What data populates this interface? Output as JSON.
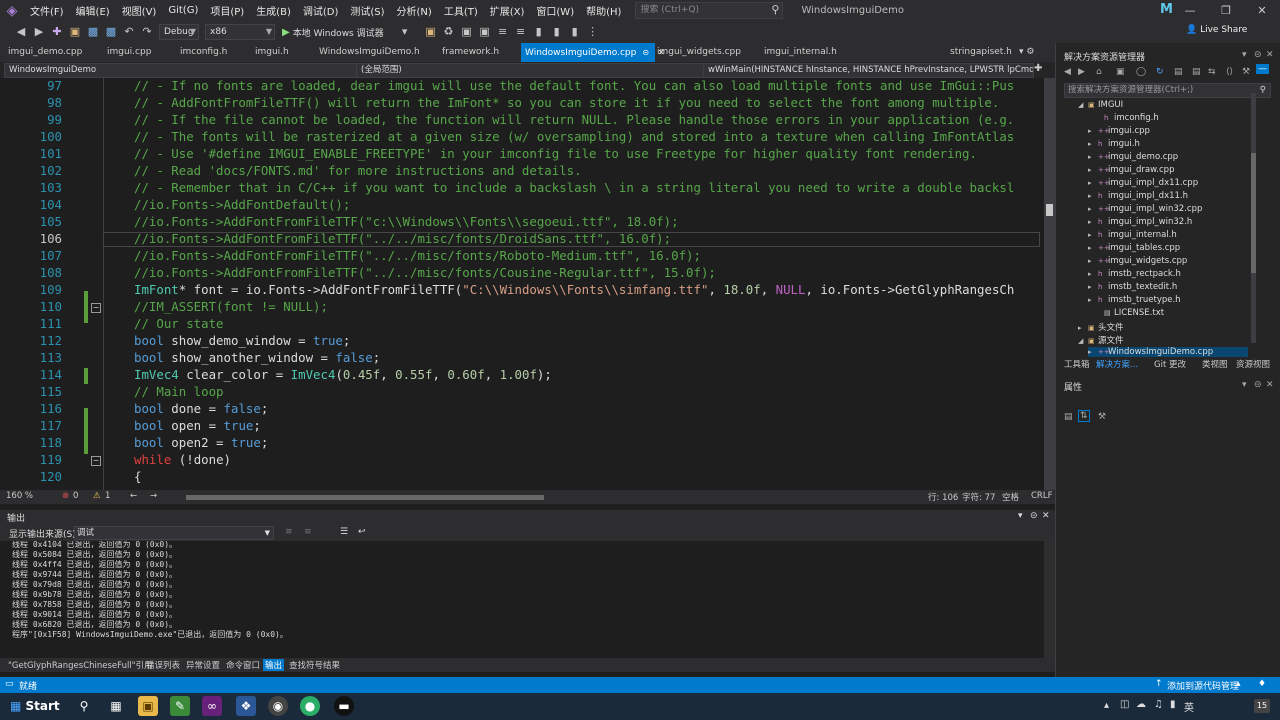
{
  "menubar": {
    "items": [
      "文件(F)",
      "编辑(E)",
      "视图(V)",
      "Git(G)",
      "项目(P)",
      "生成(B)",
      "调试(D)",
      "测试(S)",
      "分析(N)",
      "工具(T)",
      "扩展(X)",
      "窗口(W)",
      "帮助(H)"
    ],
    "search_placeholder": "搜索 (Ctrl+Q)",
    "window_title": "WindowsImguiDemo",
    "avatar_letter": "M",
    "live_share": "Live Share"
  },
  "toolbar": {
    "config": "Debug",
    "platform": "x86",
    "run_label": "本地 Windows 调试器"
  },
  "tabs": [
    {
      "label": "imgui_demo.cpp",
      "active": false
    },
    {
      "label": "imgui.cpp",
      "active": false
    },
    {
      "label": "imconfig.h",
      "active": false
    },
    {
      "label": "imgui.h",
      "active": false
    },
    {
      "label": "WindowsImguiDemo.h",
      "active": false
    },
    {
      "label": "framework.h",
      "active": false
    },
    {
      "label": "WindowsImguiDemo.cpp",
      "active": true
    },
    {
      "label": "imgui_widgets.cpp",
      "active": false
    },
    {
      "label": "imgui_internal.h",
      "active": false
    },
    {
      "label": "stringapiset.h",
      "active": false
    }
  ],
  "navbar": {
    "project": "WindowsImguiDemo",
    "scope": "(全局范围)",
    "function": "wWinMain(HINSTANCE hInstance, HINSTANCE hPrevInstance, LPWSTR lpCmdLine,"
  },
  "editor": {
    "line_numbers": [
      "97",
      "98",
      "99",
      "100",
      "101",
      "102",
      "103",
      "104",
      "105",
      "106",
      "107",
      "108",
      "109",
      "110",
      "111",
      "112",
      "113",
      "114",
      "115",
      "116",
      "117",
      "118",
      "119",
      "120"
    ],
    "lines": {
      "l97": "// - If no fonts are loaded, dear imgui will use the default font. You can also load multiple fonts and use ImGui::Pus",
      "l98": "// - AddFontFromFileTTF() will return the ImFont* so you can store it if you need to select the font among multiple.",
      "l99": "// - If the file cannot be loaded, the function will return NULL. Please handle those errors in your application (e.g.",
      "l100": "// - The fonts will be rasterized at a given size (w/ oversampling) and stored into a texture when calling ImFontAtlas",
      "l101": "// - Use '#define IMGUI_ENABLE_FREETYPE' in your imconfig file to use Freetype for higher quality font rendering.",
      "l102": "// - Read 'docs/FONTS.md' for more instructions and details.",
      "l103": "// - Remember that in C/C++ if you want to include a backslash \\ in a string literal you need to write a double backsl",
      "l104": "//io.Fonts->AddFontDefault();",
      "l105": "//io.Fonts->AddFontFromFileTTF(\"c:\\\\Windows\\\\Fonts\\\\segoeui.ttf\", 18.0f);",
      "l106": "//io.Fonts->AddFontFromFileTTF(\"../../misc/fonts/DroidSans.ttf\", 16.0f);",
      "l107": "//io.Fonts->AddFontFromFileTTF(\"../../misc/fonts/Roboto-Medium.ttf\", 16.0f);",
      "l108": "//io.Fonts->AddFontFromFileTTF(\"../../misc/fonts/Cousine-Regular.ttf\", 15.0f);",
      "l109_type": "ImFont",
      "l109_a": "* font = io.Fonts->",
      "l109_fn": "AddFontFromFileTTF",
      "l109_b": "(",
      "l109_str": "\"C:\\\\Windows\\\\Fonts\\\\simfang.ttf\"",
      "l109_c": ", ",
      "l109_num": "18.0f",
      "l109_d": ", ",
      "l109_null": "NULL",
      "l109_e": ", io.Fonts->GetGlyphRangesCh",
      "l110": "//IM_ASSERT(font != NULL);",
      "l111": "// Our state",
      "l112_kw": "bool",
      "l112_rest": " show_demo_window = ",
      "l112_val": "true",
      "l112_end": ";",
      "l113_kw": "bool",
      "l113_rest": " show_another_window = ",
      "l113_val": "false",
      "l113_end": ";",
      "l114_type": "ImVec4",
      "l114_a": " clear_color = ",
      "l114_type2": "ImVec4",
      "l114_b": "(",
      "l114_n1": "0.45f",
      "l114_n2": "0.55f",
      "l114_n3": "0.60f",
      "l114_n4": "1.00f",
      "l114_sep": ", ",
      "l114_end": ");",
      "l115": "// Main loop",
      "l116_kw": "bool",
      "l116_rest": " done = ",
      "l116_val": "false",
      "l116_end": ";",
      "l117_kw": "bool",
      "l117_rest": " open = ",
      "l117_val": "true",
      "l117_end": ";",
      "l118_kw": "bool",
      "l118_rest": " open2 = ",
      "l118_val": "true",
      "l118_end": ";",
      "l119_kw": "while",
      "l119_rest": " (!done)",
      "l120": "{"
    }
  },
  "editor_status": {
    "zoom": "160 %",
    "errors": "0",
    "warnings": "1",
    "line": "行: 106",
    "char": "字符: 77",
    "ws": "空格",
    "eol": "CRLF"
  },
  "output": {
    "title": "输出",
    "source_label": "显示输出来源(S):",
    "source_value": "调试",
    "lines": [
      "线程 0x4104 已退出，返回值为 0 (0x0)。",
      "线程 0x5084 已退出，返回值为 0 (0x0)。",
      "线程 0x4ff4 已退出，返回值为 0 (0x0)。",
      "线程 0x9744 已退出，返回值为 0 (0x0)。",
      "线程 0x79d8 已退出，返回值为 0 (0x0)。",
      "线程 0x9b78 已退出，返回值为 0 (0x0)。",
      "线程 0x7858 已退出，返回值为 0 (0x0)。",
      "线程 0x9014 已退出，返回值为 0 (0x0)。",
      "线程 0x6820 已退出，返回值为 0 (0x0)。",
      "程序\"[0x1F58] WindowsImguiDemo.exe\"已退出，返回值为 0 (0x0)。"
    ]
  },
  "bottom_tabs": [
    "\"GetGlyphRangesChineseFull\"引用",
    "错误列表",
    "异常设置",
    "命令窗口",
    "输出",
    "查找符号结果"
  ],
  "solution_explorer": {
    "title": "解决方案资源管理器",
    "search_placeholder": "搜索解决方案资源管理器(Ctrl+;)",
    "root": "IMGUI",
    "files": [
      "imconfig.h",
      "imgui.cpp",
      "imgui.h",
      "imgui_demo.cpp",
      "imgui_draw.cpp",
      "imgui_impl_dx11.cpp",
      "imgui_impl_dx11.h",
      "imgui_impl_win32.cpp",
      "imgui_impl_win32.h",
      "imgui_internal.h",
      "imgui_tables.cpp",
      "imgui_widgets.cpp",
      "imstb_rectpack.h",
      "imstb_textedit.h",
      "imstb_truetype.h",
      "LICENSE.txt"
    ],
    "folders": [
      "头文件",
      "源文件"
    ],
    "selected": "WindowsImguiDemo.cpp",
    "tabs": [
      "工具箱",
      "解决方案...",
      "Git 更改",
      "类视图",
      "资源视图"
    ],
    "properties_title": "属性"
  },
  "statusbar": {
    "ready": "就绪",
    "source_control": "添加到源代码管理"
  },
  "taskbar": {
    "start": "Start",
    "ime": "英",
    "notif_count": "15"
  },
  "colors": {
    "accent": "#007acc",
    "comment": "#57a64a",
    "keyword": "#569cd6",
    "type": "#4ec9b0",
    "string": "#d69d85",
    "number": "#b5cea8"
  }
}
